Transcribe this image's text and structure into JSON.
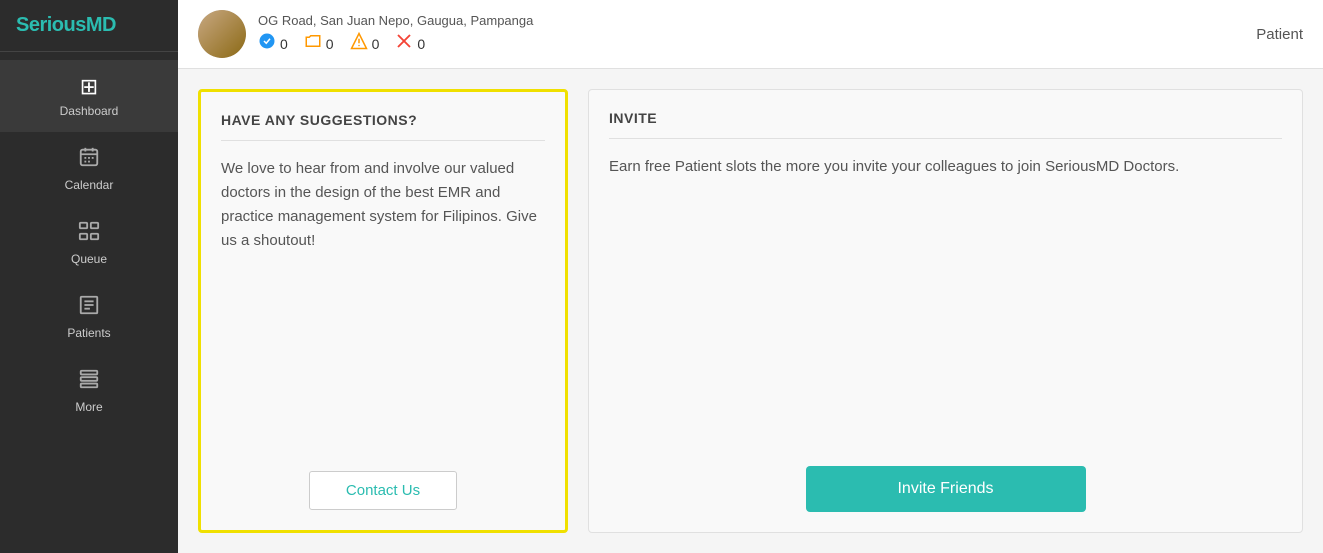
{
  "sidebar": {
    "logo": {
      "text_main": "Serious",
      "text_accent": "MD"
    },
    "items": [
      {
        "label": "Dashboard",
        "icon": "⊞",
        "active": true
      },
      {
        "label": "Calendar",
        "icon": "📅",
        "active": false
      },
      {
        "label": "Queue",
        "icon": "☰",
        "active": false
      },
      {
        "label": "Patients",
        "icon": "📋",
        "active": false
      },
      {
        "label": "More",
        "icon": "⊟",
        "active": false
      }
    ]
  },
  "topbar": {
    "address": "OG Road, San Juan Nepo, Gaugua, Pampanga",
    "badges": [
      {
        "icon": "✔",
        "count": "0",
        "type": "check"
      },
      {
        "icon": "🗂",
        "count": "0",
        "type": "folder"
      },
      {
        "icon": "⚠",
        "count": "0",
        "type": "warning"
      },
      {
        "icon": "✕",
        "count": "0",
        "type": "close"
      }
    ],
    "patient_label": "Patient"
  },
  "suggestions_card": {
    "title": "HAVE ANY SUGGESTIONS?",
    "body": "We love to hear from and involve our valued doctors in the design of the best EMR and practice management system for Filipinos. Give us a shoutout!",
    "contact_button": "Contact Us"
  },
  "invite_card": {
    "title": "INVITE",
    "body": "Earn free Patient slots the more you invite your colleagues to join SeriousMD Doctors.",
    "invite_button": "Invite Friends"
  },
  "colors": {
    "accent": "#2bbcb0",
    "sidebar_bg": "#2c2c2c",
    "yellow_border": "#f0e000"
  }
}
